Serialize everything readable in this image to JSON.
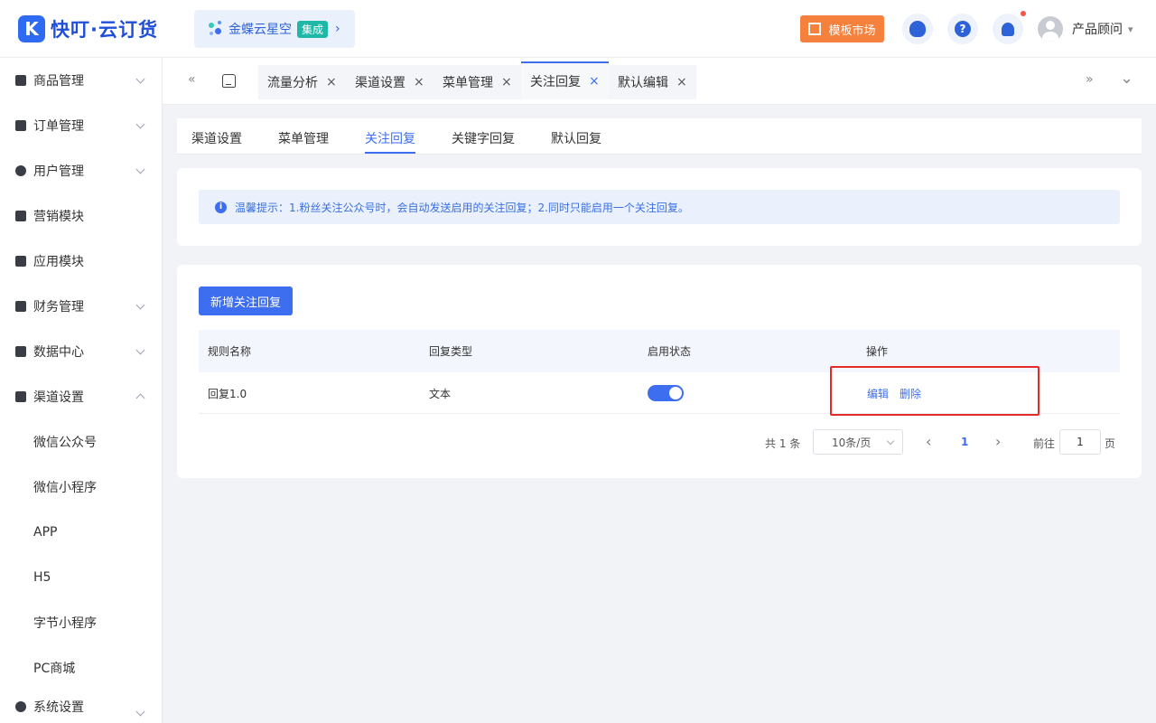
{
  "header": {
    "logo_mark": "K",
    "logo_text": "快叮·云订货",
    "brand_name": "金蝶云星空",
    "brand_tag": "集成",
    "brand_arrow": "›",
    "market_label": "模板市场",
    "help_glyph": "?",
    "user_name": "产品顾问",
    "user_caret": "▾"
  },
  "sidebar": {
    "items": [
      {
        "label": "商品管理",
        "icon": "shopping-bag-icon"
      },
      {
        "label": "订单管理",
        "icon": "clipboard-icon"
      },
      {
        "label": "用户管理",
        "icon": "user-icon"
      },
      {
        "label": "营销模块",
        "icon": "trend-chart-icon"
      },
      {
        "label": "应用模块",
        "icon": "grid-icon"
      },
      {
        "label": "财务管理",
        "icon": "wallet-icon"
      },
      {
        "label": "数据中心",
        "icon": "bar-chart-icon"
      },
      {
        "label": "渠道设置",
        "icon": "list-icon"
      }
    ],
    "sub_items": [
      "微信公众号",
      "微信小程序",
      "APP",
      "H5",
      "字节小程序",
      "PC商城"
    ],
    "last_item": {
      "label": "系统设置",
      "icon": "gear-icon"
    }
  },
  "tabs": {
    "back_glyph": "«",
    "forward_glyph": "»",
    "more_glyph": "⌄",
    "close_glyph": "×",
    "items": [
      "流量分析",
      "渠道设置",
      "菜单管理",
      "关注回复",
      "默认编辑"
    ],
    "active_index": 3
  },
  "subtabs": {
    "items": [
      "渠道设置",
      "菜单管理",
      "关注回复",
      "关键字回复",
      "默认回复"
    ],
    "active_index": 2
  },
  "notice": {
    "icon_glyph": "i",
    "text": "温馨提示：1.粉丝关注公众号时，会自动发送启用的关注回复；2.同时只能启用一个关注回复。"
  },
  "table": {
    "add_button": "新增关注回复",
    "columns": [
      "规则名称",
      "回复类型",
      "启用状态",
      "操作"
    ],
    "rows": [
      {
        "name": "回复1.0",
        "type": "文本",
        "enabled": true,
        "actions": [
          "编辑",
          "删除"
        ]
      }
    ]
  },
  "pagination": {
    "total": "共 1 条",
    "page_size": "10条/页",
    "prev_glyph": "‹",
    "next_glyph": "›",
    "current_page": "1",
    "goto_label": "前往",
    "goto_value": "1",
    "page_suffix": "页"
  },
  "colors": {
    "primary": "#3d6ef0",
    "market": "#f5813d",
    "highlight": "#e52a2a"
  }
}
